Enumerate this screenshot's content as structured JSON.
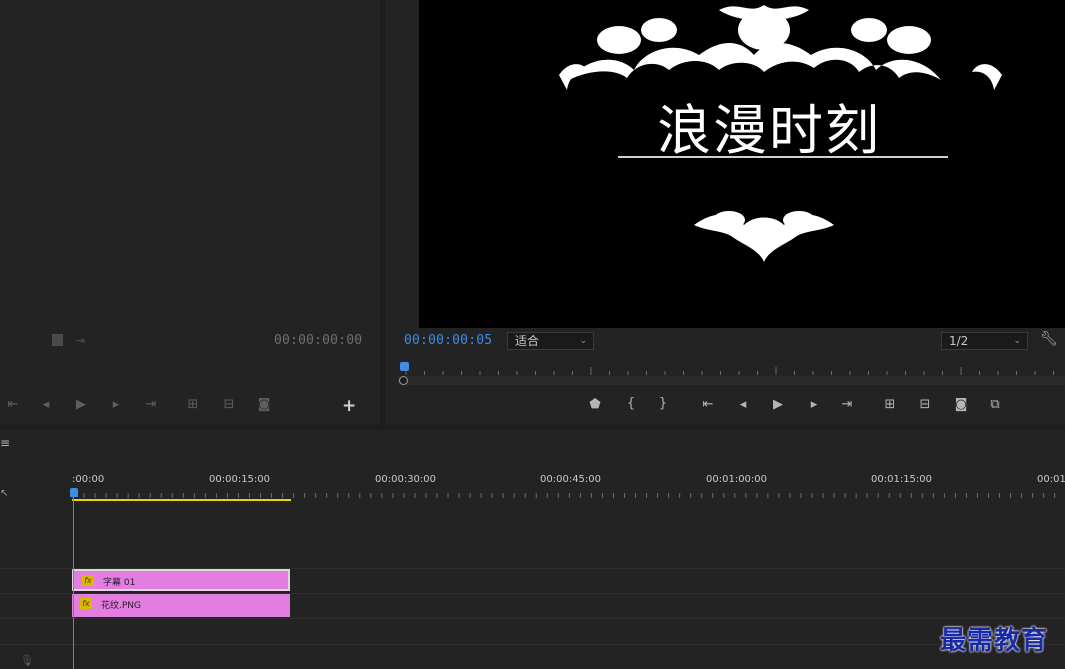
{
  "source_monitor": {
    "timecode": "00:00:00:00",
    "add_button": "+"
  },
  "program_monitor": {
    "title_text": "浪漫时刻",
    "timecode": "00:00:00:05",
    "fit_value": "适合",
    "resolution_value": "1/2",
    "playhead_fraction": 0.01
  },
  "timeline": {
    "ruler_labels": [
      ":00:00",
      "00:00:15:00",
      "00:00:30:00",
      "00:00:45:00",
      "00:01:00:00",
      "00:01:15:00",
      "00:01:"
    ],
    "tracks": {
      "v2_clip_name": "字幕 01",
      "v1_clip_name": "花纹.PNG",
      "fx_badge": "fx"
    }
  },
  "watermark": "最需教育",
  "colors": {
    "accent_blue": "#3e8ce6",
    "clip_pink": "#e27ee0",
    "work_area_yellow": "#e8d400"
  }
}
